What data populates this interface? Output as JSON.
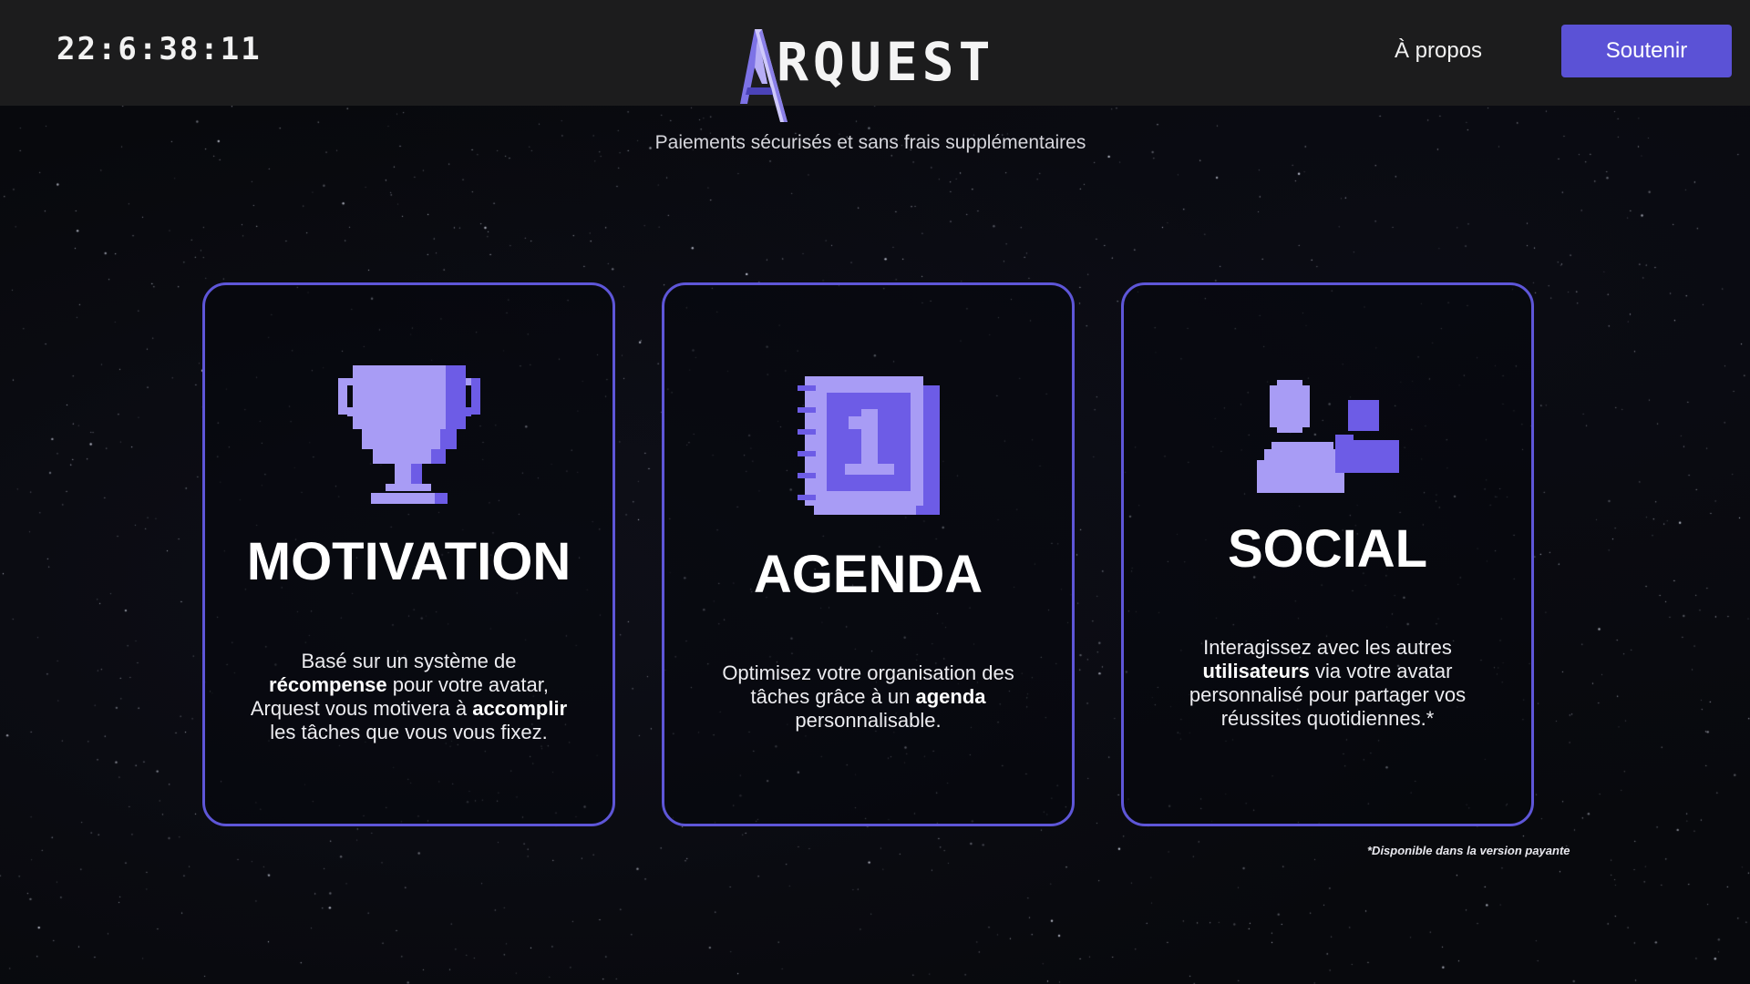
{
  "header": {
    "clock": "22:6:38:11",
    "logo_text": "RQUEST",
    "nav_about_label": "À propos",
    "support_button_label": "Soutenir"
  },
  "tagline": "Paiements sécurisés et sans frais supplémentaires",
  "cards": [
    {
      "icon": "trophy-icon",
      "title": "MOTIVATION",
      "text": [
        {
          "t": "Basé sur un système de",
          "b": false
        },
        {
          "br": true
        },
        {
          "t": "récompense",
          "b": true
        },
        {
          "t": " pour votre avatar,",
          "b": false
        },
        {
          "br": true
        },
        {
          "t": "Arquest vous motivera à ",
          "b": false
        },
        {
          "t": "accomplir",
          "b": true
        },
        {
          "br": true
        },
        {
          "t": "les tâches que vous vous fixez.",
          "b": false
        }
      ]
    },
    {
      "icon": "calendar-icon",
      "title": "AGENDA",
      "text": [
        {
          "t": "Optimisez votre organisation des",
          "b": false
        },
        {
          "br": true
        },
        {
          "t": "tâches grâce à un ",
          "b": false
        },
        {
          "t": "agenda",
          "b": true
        },
        {
          "br": true
        },
        {
          "t": "personnalisable.",
          "b": false
        }
      ]
    },
    {
      "icon": "user-chat-icon",
      "title": "SOCIAL",
      "text": [
        {
          "t": "Interagissez avec les autres",
          "b": false
        },
        {
          "br": true
        },
        {
          "t": "utilisateurs",
          "b": true
        },
        {
          "t": " via votre avatar",
          "b": false
        },
        {
          "br": true
        },
        {
          "t": "personnalisé pour partager vos",
          "b": false
        },
        {
          "br": true
        },
        {
          "t": "réussites quotidiennes.*",
          "b": false
        }
      ]
    }
  ],
  "footnote": "*Disponible dans la version payante",
  "colors": {
    "accent": "#5b52d6",
    "card_border": "#5e56d8",
    "icon_light": "#a89cf5",
    "icon_dark": "#6d5ce6",
    "header_bg": "#1c1c1d"
  }
}
